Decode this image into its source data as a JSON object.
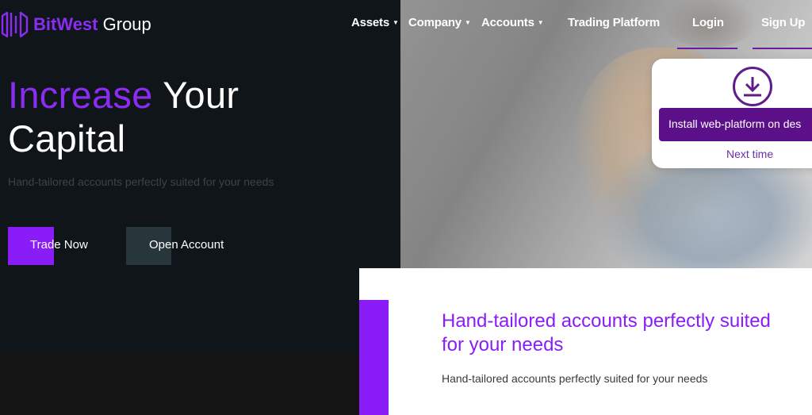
{
  "brand": {
    "name_part1": "BitWest",
    "name_part2": "Group",
    "accent_color": "#8a1cf7",
    "logo_icon": "bars-logo-icon"
  },
  "nav": {
    "assets": "Assets",
    "company": "Company",
    "accounts": "Accounts",
    "trading_platform": "Trading Platform",
    "login": "Login",
    "signup": "Sign Up",
    "caret_icon": "chevron-down-icon"
  },
  "hero": {
    "title_accent": "Increase",
    "title_rest_line1": "Your",
    "title_line2": "Capital",
    "subtitle": "Hand-tailored accounts perfectly suited for your needs",
    "trade_button": "Trade Now",
    "open_button": "Open Account"
  },
  "popup": {
    "icon": "download-icon",
    "install_label": "Install web-platform on des",
    "next_time": "Next time"
  },
  "card": {
    "title_line1": "Hand-tailored accounts perfectly suited",
    "title_line2": "for your needs",
    "subtitle": "Hand-tailored accounts perfectly suited for your needs"
  }
}
